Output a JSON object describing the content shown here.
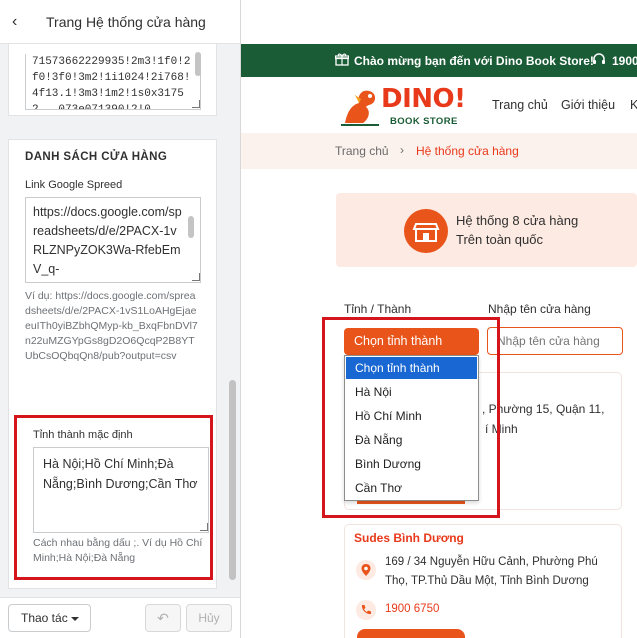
{
  "panel": {
    "title": "Trang Hệ thống cửa hàng",
    "top_textarea_value": "71573662229935!2m3!1f0!2f0!3f0!3m2!1i1024!2i768!4f13.1!3m3!1m2!1s0x31752...073e071390!2!0",
    "section_title": "DANH SÁCH CỬA HÀNG",
    "link_label": "Link Google Spreed",
    "link_value": "https://docs.google.com/spreadsheets/d/e/2PACX-1vRLZNPyZOK3Wa-RfebEmV_q-",
    "link_hint": "Ví dụ: https://docs.google.com/spreadsheets/d/e/2PACX-1vS1LoAHgEjaeeuITh0yiBZbhQMyp-kb_BxqFbnDVl7n22uMZGYpGs8gD2O6QcqP2B8YTUbCsOQbqQn8/pub?output=csv",
    "province_label": "Tỉnh thành mặc định",
    "province_value": "Hà Nội;Hồ Chí Minh;Đà Nẵng;Bình Dương;Cần Thơ",
    "province_hint": "Cách nhau bằng dấu ;. Ví dụ Hồ Chí Minh;Hà Nội;Đà Nẵng",
    "actions_label": "Thao tác",
    "undo_icon": "↶",
    "cancel_label": "Hủy"
  },
  "site": {
    "welcome": "Chào mừng bạn đến với Dino Book Store!",
    "hotline": "1900",
    "logo_word": "DINO!",
    "logo_sub": "BOOK STORE",
    "nav": [
      "Trang chủ",
      "Giới thiệu",
      "K"
    ],
    "breadcrumb_home": "Trang chủ",
    "breadcrumb_sep": "›",
    "breadcrumb_current": "Hệ thống cửa hàng",
    "hero_line1": "Hệ thống 8 cửa hàng",
    "hero_line2": "Trên toàn quốc",
    "filter_province_label": "Tỉnh / Thành",
    "filter_name_label": "Nhập tên cửa hàng",
    "select_value": "Chọn tỉnh thành",
    "name_placeholder": "Nhập tên cửa hàng",
    "dropdown_options": [
      "Chọn tỉnh thành",
      "Hà Nội",
      "Hồ Chí Minh",
      "Đà Nẵng",
      "Bình Dương",
      "Cần Thơ"
    ],
    "card_a_text1": ", Phường 15, Quận 11,",
    "card_a_text2": "í Minh",
    "card_b_name": "Sudes Bình Dương",
    "card_b_address": "169 / 34 Nguyễn Hữu Cảnh, Phường Phú Thọ, TP.Thủ Dầu Một, Tỉnh Bình Dương",
    "card_b_phone": "1900 6750"
  },
  "colors": {
    "accent_orange": "#e8541a",
    "brand_green": "#1a5c36",
    "highlight_red": "#d4161c",
    "dropdown_selected": "#1967d2"
  }
}
